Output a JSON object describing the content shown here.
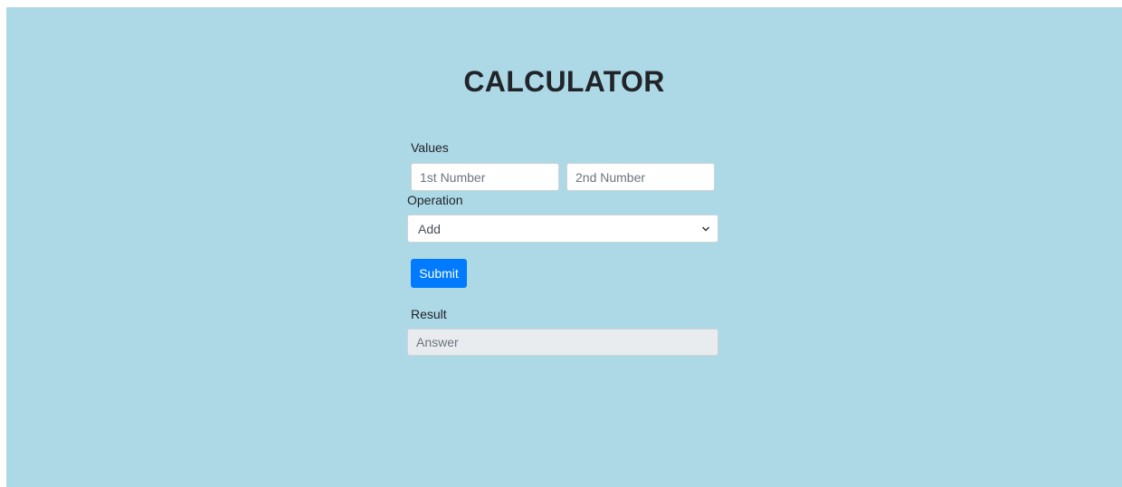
{
  "page": {
    "title": "CALCULATOR",
    "background_color": "#add8e6"
  },
  "form": {
    "values_label": "Values",
    "first_number": {
      "placeholder": "1st Number",
      "value": ""
    },
    "second_number": {
      "placeholder": "2nd Number",
      "value": ""
    },
    "operation_label": "Operation",
    "operation": {
      "selected": "Add",
      "icon": "chevron-down-icon"
    },
    "submit_label": "Submit",
    "submit_color": "#007bff",
    "result_label": "Result",
    "result": {
      "placeholder": "Answer",
      "value": ""
    }
  }
}
